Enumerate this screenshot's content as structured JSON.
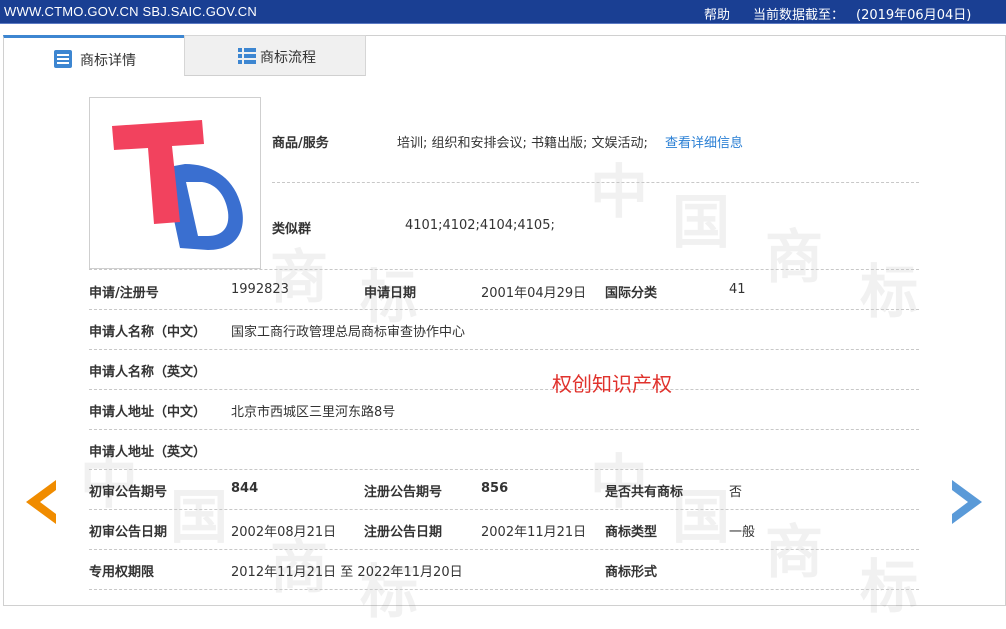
{
  "topbar": {
    "sites": "WWW.CTMO.GOV.CN SBJ.SAIC.GOV.CN",
    "help": "帮助",
    "date_label": "当前数据截至：",
    "date_value": "(2019年06月04日)"
  },
  "tabs": [
    {
      "label": "商标详情",
      "icon": "list-detail-icon",
      "active": true
    },
    {
      "label": "商标流程",
      "icon": "list-flow-icon",
      "active": false
    }
  ],
  "colors": {
    "accent": "#3d86d1",
    "topbar": "#1a3f93",
    "brand_text": "#e0322c",
    "link": "#2a7fd4",
    "prev_arrow": "#f08c00",
    "next_arrow": "#5a9ad8"
  },
  "detail": {
    "goods_label": "商品/服务",
    "goods_value": "培训; 组织和安排会议; 书籍出版; 文娱活动;",
    "goods_link": "查看详细信息",
    "similar_label": "类似群",
    "similar_value": "4101;4102;4104;4105;",
    "reg_no_label": "申请/注册号",
    "reg_no_value": "1992823",
    "apply_date_label": "申请日期",
    "apply_date_value": "2001年04月29日",
    "intl_class_label": "国际分类",
    "intl_class_value": "41",
    "applicant_cn_label": "申请人名称（中文）",
    "applicant_cn_value": "国家工商行政管理总局商标审查协作中心",
    "applicant_en_label": "申请人名称（英文）",
    "address_cn_label": "申请人地址（中文）",
    "address_cn_value": "北京市西城区三里河东路8号",
    "address_en_label": "申请人地址（英文）",
    "prelim_no_label": "初审公告期号",
    "prelim_no_value": "844",
    "reg_pub_no_label": "注册公告期号",
    "reg_pub_no_value": "856",
    "shared_label": "是否共有商标",
    "shared_value": "否",
    "prelim_date_label": "初审公告日期",
    "prelim_date_value": "2002年08月21日",
    "reg_pub_date_label": "注册公告日期",
    "reg_pub_date_value": "2002年11月21日",
    "type_label": "商标类型",
    "type_value": "一般",
    "term_label": "专用权期限",
    "term_value": "2012年11月21日 至 2022年11月20日",
    "form_label": "商标形式"
  },
  "brand_text": "权创知识产权"
}
